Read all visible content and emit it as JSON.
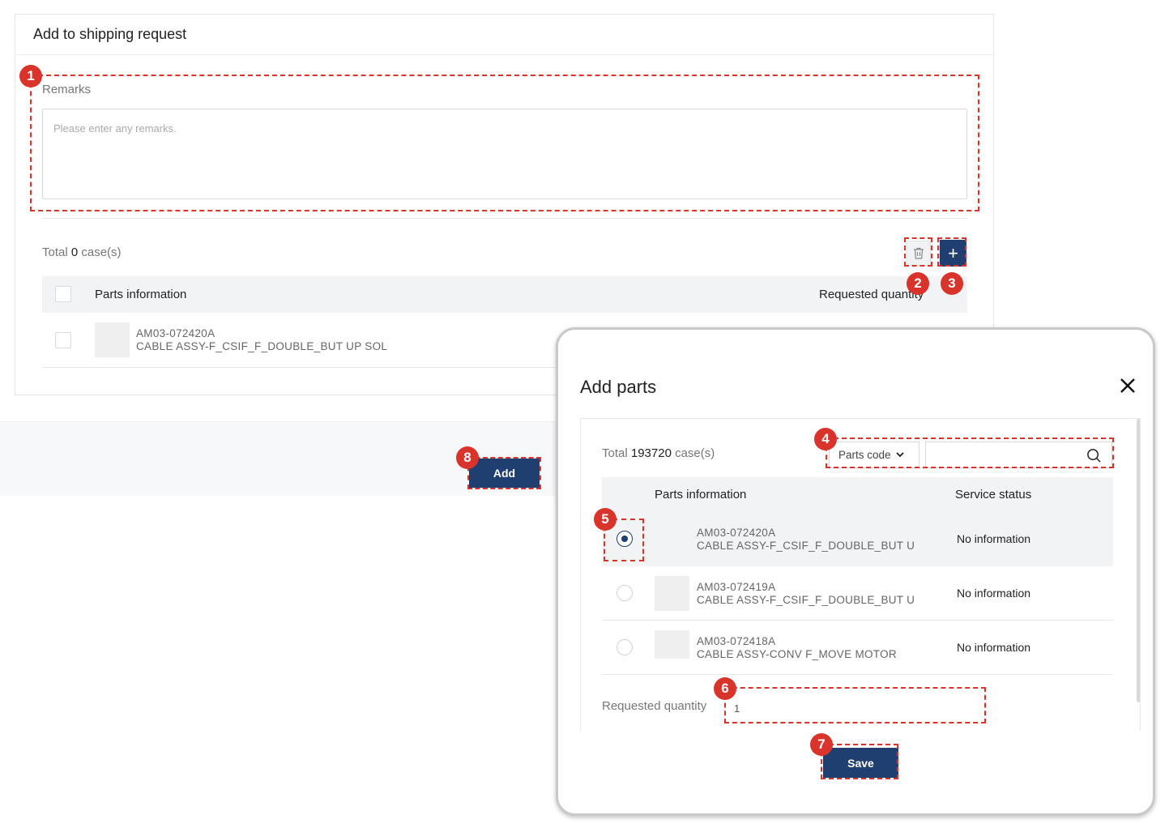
{
  "page": {
    "title": "Add to shipping request",
    "remarks_label": "Remarks",
    "remarks_placeholder": "Please enter any remarks.",
    "total_prefix": "Total",
    "total_count": "0",
    "total_suffix": "case(s)",
    "table_headers": {
      "parts": "Parts information",
      "qty": "Requested quantity"
    },
    "rows": [
      {
        "code": "AM03-072420A",
        "name": "CABLE ASSY-F_CSIF_F_DOUBLE_BUT UP SOL"
      }
    ],
    "add_button": "Add"
  },
  "modal": {
    "title": "Add parts",
    "total_prefix": "Total",
    "total_count": "193720",
    "total_suffix": "case(s)",
    "search_field": "Parts code",
    "search_value": "",
    "table_headers": {
      "parts": "Parts information",
      "status": "Service status"
    },
    "rows": [
      {
        "code": "AM03-072420A",
        "name": "CABLE ASSY-F_CSIF_F_DOUBLE_BUT U",
        "status": "No information",
        "selected": true
      },
      {
        "code": "AM03-072419A",
        "name": "CABLE ASSY-F_CSIF_F_DOUBLE_BUT U",
        "status": "No information",
        "selected": false
      },
      {
        "code": "AM03-072418A",
        "name": "CABLE ASSY-CONV F_MOVE MOTOR",
        "status": "No information",
        "selected": false
      }
    ],
    "requested_quantity_label": "Requested quantity",
    "requested_quantity_value": "1",
    "save_button": "Save"
  },
  "annotations": [
    "1",
    "2",
    "3",
    "4",
    "5",
    "6",
    "7",
    "8"
  ],
  "colors": {
    "primary": "#1f3f70",
    "annotation": "#d9342b"
  }
}
